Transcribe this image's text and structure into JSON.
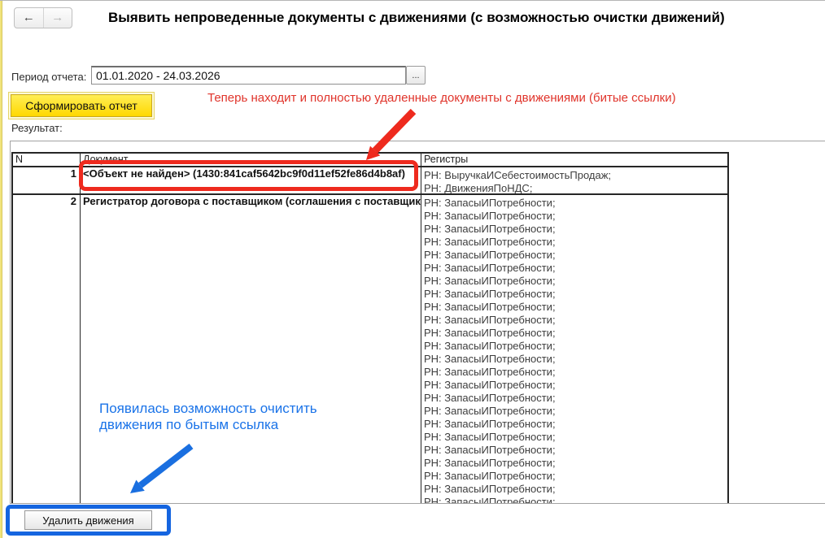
{
  "nav": {
    "back_icon": "←",
    "forward_icon": "→"
  },
  "title": "Выявить непроведенные документы с движениями (с возможностью очистки движений)",
  "period": {
    "label": "Период отчета:",
    "value": "01.01.2020 - 24.03.2026",
    "picker_label": "..."
  },
  "toolbar": {
    "generate_label": "Сформировать отчет"
  },
  "annotations": {
    "red_note": "Теперь находит и полностью удаленные документы с движениями (битые ссылки)",
    "blue_note_line1": "Появилась возможность очистить",
    "blue_note_line2": "движения по бытым ссылка"
  },
  "result": {
    "label": "Результат:",
    "table": {
      "headers": [
        "N",
        "Документ",
        "Регистры"
      ],
      "rows": [
        {
          "n": "1",
          "document": "<Объект не найден> (1430:841caf5642bc9f0d11ef52fe86d4b8af)",
          "registers": [
            "РН: ВыручкаИСебестоимостьПродаж;",
            "РН: ДвиженияПоНДС;"
          ]
        },
        {
          "n": "2",
          "document": "Регистратор договора с поставщиком (соглашения с поставщик",
          "registers": [
            "РН: ЗапасыИПотребности;",
            "РН: ЗапасыИПотребности;",
            "РН: ЗапасыИПотребности;",
            "РН: ЗапасыИПотребности;",
            "РН: ЗапасыИПотребности;",
            "РН: ЗапасыИПотребности;",
            "РН: ЗапасыИПотребности;",
            "РН: ЗапасыИПотребности;",
            "РН: ЗапасыИПотребности;",
            "РН: ЗапасыИПотребности;",
            "РН: ЗапасыИПотребности;",
            "РН: ЗапасыИПотребности;",
            "РН: ЗапасыИПотребности;",
            "РН: ЗапасыИПотребности;",
            "РН: ЗапасыИПотребности;",
            "РН: ЗапасыИПотребности;",
            "РН: ЗапасыИПотребности;",
            "РН: ЗапасыИПотребности;",
            "РН: ЗапасыИПотребности;",
            "РН: ЗапасыИПотребности;",
            "РН: ЗапасыИПотребности;",
            "РН: ЗапасыИПотребности;",
            "РН: ЗапасыИПотребности;",
            "РН: ЗапасыИПотребности;"
          ]
        }
      ]
    }
  },
  "footer": {
    "delete_button_label": "Удалить движения"
  },
  "colors": {
    "highlight_red": "#ee2a1e",
    "annotation_red_text": "#e0342b",
    "highlight_blue": "#1565e0",
    "annotation_blue_text": "#1a73e8",
    "button_yellow": "#ffd800"
  }
}
